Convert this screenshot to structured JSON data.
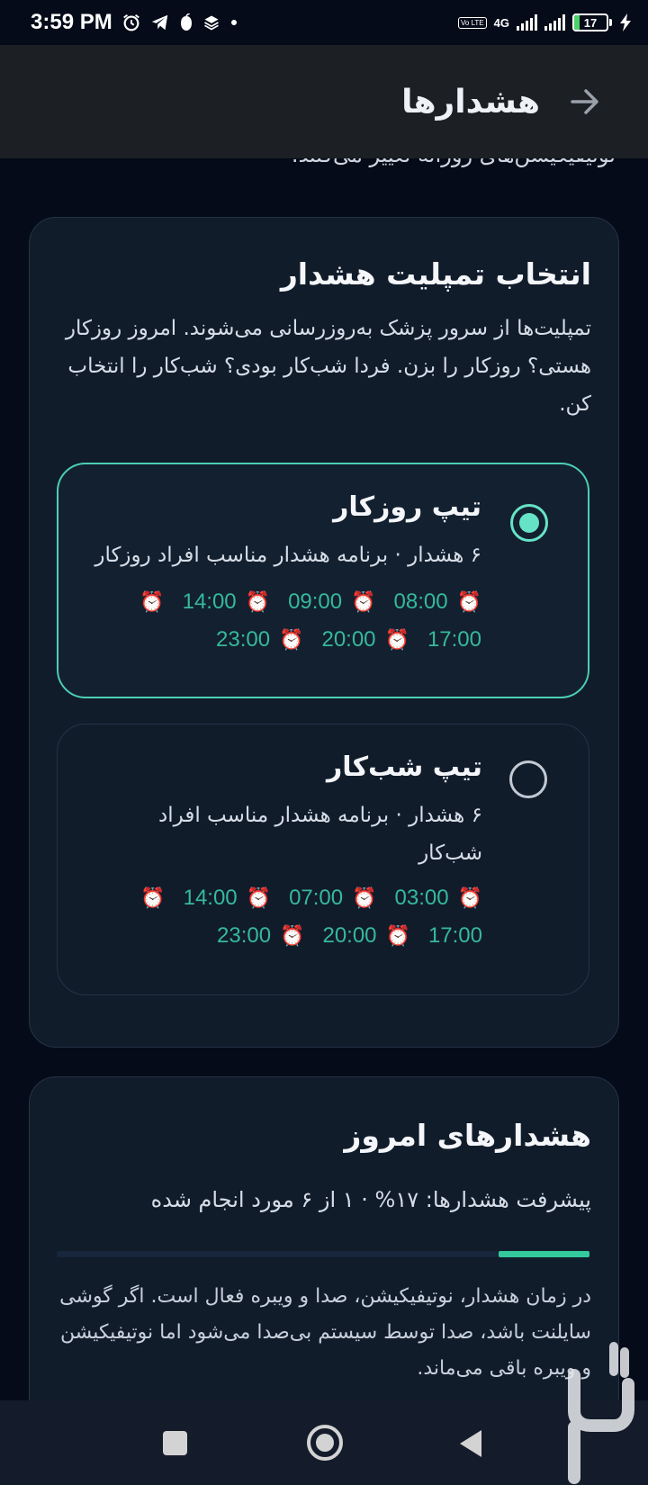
{
  "status_bar": {
    "time": "3:59 PM",
    "network": "4G",
    "volte": "Vo LTE",
    "battery": "17",
    "battery_level": 0.17,
    "icons": [
      "alarm-icon",
      "telegram-icon",
      "notification-icon",
      "layers-icon",
      "dot-icon"
    ]
  },
  "app_bar": {
    "title": "هشدارها",
    "back_icon": "arrow-right-icon"
  },
  "clipped_text": "نوتیفیکیشن‌های روزانه تغییر می‌کنند.",
  "template_card": {
    "title": "انتخاب تمپلیت هشدار",
    "description": "تمپلیت‌ها از سرور پزشک به‌روزرسانی می‌شوند. امروز روزکار هستی؟ روزکار را بزن. فردا شب‌کار بودی؟ شب‌کار را انتخاب کن.",
    "options": [
      {
        "title": "تیپ روزکار",
        "subtitle": "۶ هشدار · برنامه هشدار مناسب افراد روزکار",
        "selected": true,
        "times_row1": [
          "08:00",
          "09:00",
          "14:00"
        ],
        "times_row2": [
          "17:00",
          "20:00",
          "23:00"
        ]
      },
      {
        "title": "تیپ شب‌کار",
        "subtitle": "۶ هشدار · برنامه هشدار مناسب افراد شب‌کار",
        "selected": false,
        "times_row1": [
          "03:00",
          "07:00",
          "14:00"
        ],
        "times_row2": [
          "17:00",
          "20:00",
          "23:00"
        ]
      }
    ]
  },
  "today_card": {
    "title": "هشدارهای امروز",
    "progress_text": "پیشرفت هشدارها: ۱۷% · ۱ از ۶ مورد انجام شده",
    "progress": 0.17,
    "note": "در زمان هشدار، نوتیفیکیشن، صدا و ویبره فعال است. اگر گوشی سایلنت باشد، صدا توسط سیستم بی‌صدا می‌شود اما نوتیفیکیشن و ویبره باقی می‌ماند."
  },
  "nav_bar": {
    "recents_icon": "square-icon",
    "home_icon": "circle-icon",
    "back_icon": "triangle-back-icon"
  },
  "colors": {
    "background": "#050b18",
    "card": "#111c2b",
    "accent": "#4ccfb2",
    "time_text": "#36b99a",
    "progress": "#34c99d",
    "app_bar": "#1c1f24"
  }
}
